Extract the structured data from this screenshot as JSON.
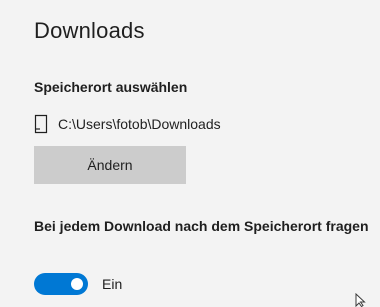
{
  "page": {
    "title": "Downloads"
  },
  "location": {
    "heading": "Speicherort auswählen",
    "path": "C:\\Users\\fotob\\Downloads",
    "path_icon": "device-icon",
    "change_button_label": "Ändern"
  },
  "ask_on_download": {
    "label": "Bei jedem Download nach dem Speicherort fragen",
    "toggle_state_label": "Ein",
    "toggle_on": true
  },
  "colors": {
    "accent": "#0078d4",
    "background": "#f3f3f3",
    "button": "#cccccc"
  }
}
